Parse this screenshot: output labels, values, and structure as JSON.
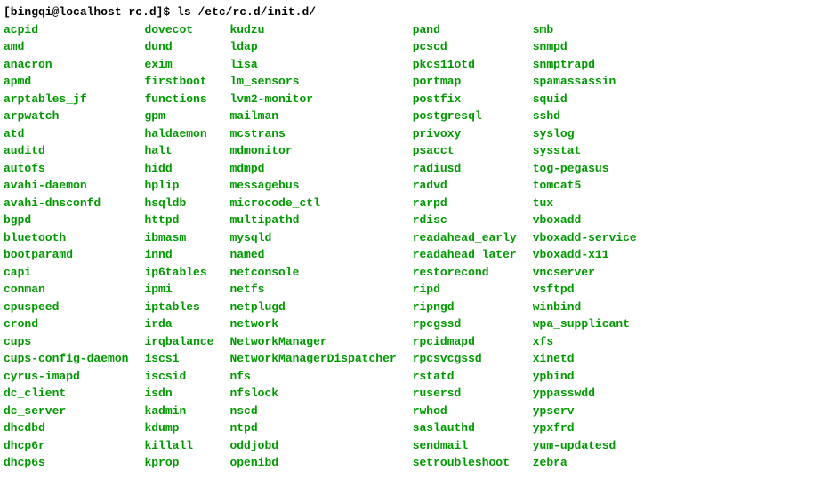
{
  "prompt": {
    "user_host_path": "[bingqi@localhost rc.d]$ ",
    "command": "ls /etc/rc.d/init.d/"
  },
  "columns": [
    [
      "acpid",
      "amd",
      "anacron",
      "apmd",
      "arptables_jf",
      "arpwatch",
      "atd",
      "auditd",
      "autofs",
      "avahi-daemon",
      "avahi-dnsconfd",
      "bgpd",
      "bluetooth",
      "bootparamd",
      "capi",
      "conman",
      "cpuspeed",
      "crond",
      "cups",
      "cups-config-daemon",
      "cyrus-imapd",
      "dc_client",
      "dc_server",
      "dhcdbd",
      "dhcp6r",
      "dhcp6s"
    ],
    [
      "dovecot",
      "dund",
      "exim",
      "firstboot",
      "functions",
      "gpm",
      "haldaemon",
      "halt",
      "hidd",
      "hplip",
      "hsqldb",
      "httpd",
      "ibmasm",
      "innd",
      "ip6tables",
      "ipmi",
      "iptables",
      "irda",
      "irqbalance",
      "iscsi",
      "iscsid",
      "isdn",
      "kadmin",
      "kdump",
      "killall",
      "kprop"
    ],
    [
      "kudzu",
      "ldap",
      "lisa",
      "lm_sensors",
      "lvm2-monitor",
      "mailman",
      "mcstrans",
      "mdmonitor",
      "mdmpd",
      "messagebus",
      "microcode_ctl",
      "multipathd",
      "mysqld",
      "named",
      "netconsole",
      "netfs",
      "netplugd",
      "network",
      "NetworkManager",
      "NetworkManagerDispatcher",
      "nfs",
      "nfslock",
      "nscd",
      "ntpd",
      "oddjobd",
      "openibd"
    ],
    [
      "pand",
      "pcscd",
      "pkcs11otd",
      "portmap",
      "postfix",
      "postgresql",
      "privoxy",
      "psacct",
      "radiusd",
      "radvd",
      "rarpd",
      "rdisc",
      "readahead_early",
      "readahead_later",
      "restorecond",
      "ripd",
      "ripngd",
      "rpcgssd",
      "rpcidmapd",
      "rpcsvcgssd",
      "rstatd",
      "rusersd",
      "rwhod",
      "saslauthd",
      "sendmail",
      "setroubleshoot"
    ],
    [
      "smb",
      "snmpd",
      "snmptrapd",
      "spamassassin",
      "squid",
      "sshd",
      "syslog",
      "sysstat",
      "tog-pegasus",
      "tomcat5",
      "tux",
      "vboxadd",
      "vboxadd-service",
      "vboxadd-x11",
      "vncserver",
      "vsftpd",
      "winbind",
      "wpa_supplicant",
      "xfs",
      "xinetd",
      "ypbind",
      "yppasswdd",
      "ypserv",
      "ypxfrd",
      "yum-updatesd",
      "zebra"
    ]
  ]
}
